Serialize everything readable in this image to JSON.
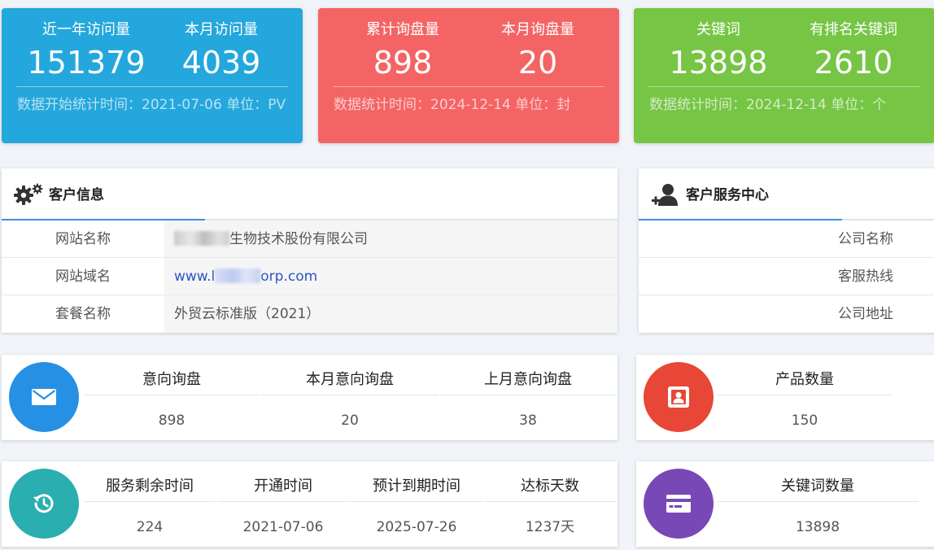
{
  "stats": [
    {
      "theme": "blue",
      "metric1": {
        "label": "近一年访问量",
        "value": "151379"
      },
      "metric2": {
        "label": "本月访问量",
        "value": "4039"
      },
      "footer": "数据开始统计时间：2021-07-06    单位：PV"
    },
    {
      "theme": "red",
      "metric1": {
        "label": "累计询盘量",
        "value": "898"
      },
      "metric2": {
        "label": "本月询盘量",
        "value": "20"
      },
      "footer": "数据统计时间：2024-12-14    单位：封"
    },
    {
      "theme": "green",
      "metric1": {
        "label": "关键词",
        "value": "13898"
      },
      "metric2": {
        "label": "有排名关键词",
        "value": "2610"
      },
      "footer": "数据统计时间：2024-12-14    单位：个"
    }
  ],
  "customer": {
    "title": "客户信息",
    "rows": [
      {
        "key": "网站名称",
        "value": "生物技术股份有限公司"
      },
      {
        "key": "网站域名",
        "value_prefix": "www.l",
        "value_suffix": "orp.com"
      },
      {
        "key": "套餐名称",
        "value": "外贸云标准版（2021）"
      }
    ]
  },
  "service": {
    "title": "客户服务中心",
    "rows": [
      {
        "key": "公司名称"
      },
      {
        "key": "客服热线"
      },
      {
        "key": "公司地址"
      }
    ]
  },
  "inquiry": {
    "cols": [
      {
        "label": "意向询盘",
        "value": "898"
      },
      {
        "label": "本月意向询盘",
        "value": "20"
      },
      {
        "label": "上月意向询盘",
        "value": "38"
      }
    ]
  },
  "product": {
    "label": "产品数量",
    "value": "150"
  },
  "service_time": {
    "cols": [
      {
        "label": "服务剩余时间",
        "value": "224"
      },
      {
        "label": "开通时间",
        "value": "2021-07-06"
      },
      {
        "label": "预计到期时间",
        "value": "2025-07-26"
      },
      {
        "label": "达标天数",
        "value": "1237天"
      }
    ]
  },
  "keywords": {
    "label": "关键词数量",
    "value": "13898"
  },
  "colors": {
    "blue": "#24a7dc",
    "red": "#f46464",
    "green": "#76c545",
    "accent": "#3f8ee2",
    "link": "#2b55c5",
    "mail_circle": "#2590e4",
    "product_circle": "#e84637",
    "time_circle": "#2aaeb0",
    "keyword_circle": "#7848b6"
  },
  "icons": {
    "customer_header": "gears-icon",
    "service_header": "user-plus-icon",
    "inquiry": "mail-icon",
    "product": "portrait-icon",
    "service_time": "history-icon",
    "keywords": "credit-card-icon"
  }
}
